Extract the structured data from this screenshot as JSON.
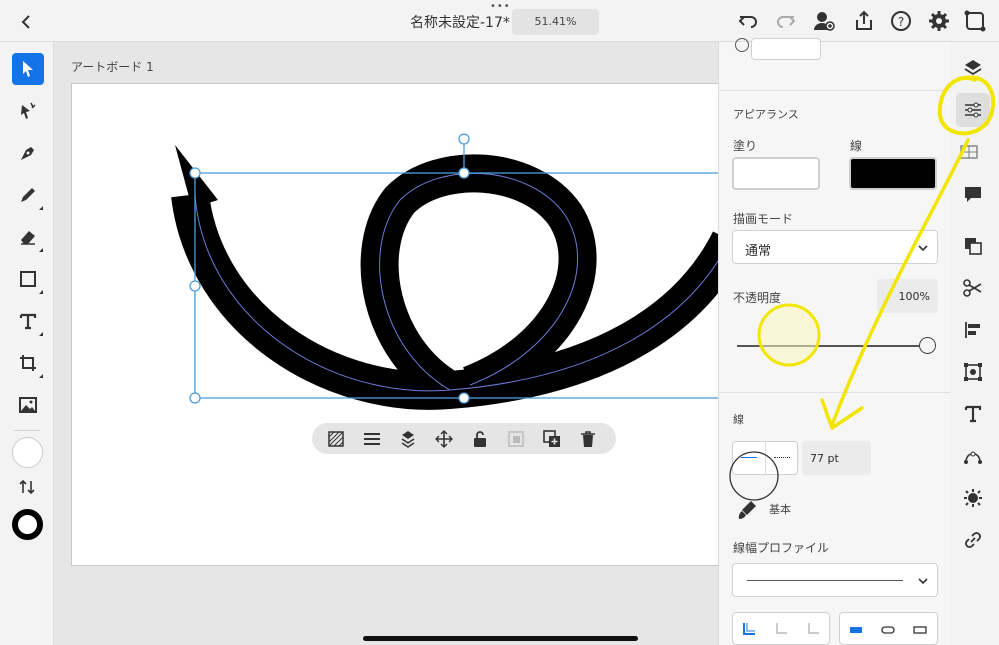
{
  "topbar": {
    "title": "名称未設定-17*",
    "zoom": "51.41%",
    "icons": [
      "chevron-left-icon",
      "undo-icon",
      "redo-icon",
      "add-user-icon",
      "share-icon",
      "help-icon",
      "gear-icon",
      "flip-icon"
    ]
  },
  "left_toolbar": {
    "tools": [
      "selection-tool",
      "direct-selection-tool",
      "pen-tool",
      "pencil-tool",
      "eraser-tool",
      "rectangle-tool",
      "type-tool",
      "artboard-tool",
      "image-tool"
    ],
    "active_tool": "selection-tool",
    "fill_color": "#ffffff",
    "stroke_color": "#000000"
  },
  "canvas": {
    "artboard_label": "アートボード 1"
  },
  "context_bar": {
    "icons": [
      "pattern-icon",
      "menu-icon",
      "arrange-icon",
      "move-icon",
      "lock-icon",
      "mask-icon",
      "duplicate-icon",
      "trash-icon"
    ]
  },
  "panel": {
    "appearance_heading": "アピアランス",
    "fill_label": "塗り",
    "stroke_label": "線",
    "fill_color": "#ffffff",
    "stroke_color": "#000000",
    "blend_mode_label": "描画モード",
    "blend_mode_value": "通常",
    "opacity_label": "不透明度",
    "opacity_value": "100%",
    "opacity_level": 1.0,
    "stroke_section_label": "線",
    "stroke_width_value": "77 pt",
    "brush_label": "基本",
    "profile_label": "線幅プロファイル"
  },
  "rail": {
    "icons": [
      "layers-icon",
      "properties-icon",
      "comments-icon",
      "pathfinder-icon",
      "scissors-icon",
      "align-icon",
      "transform-icon",
      "type-icon",
      "path-icon",
      "symbol-icon",
      "link-icon"
    ],
    "active": "properties-icon"
  },
  "colors": {
    "accent": "#1473e6",
    "annotation": "#f2e600",
    "selection": "#4a9ede"
  }
}
